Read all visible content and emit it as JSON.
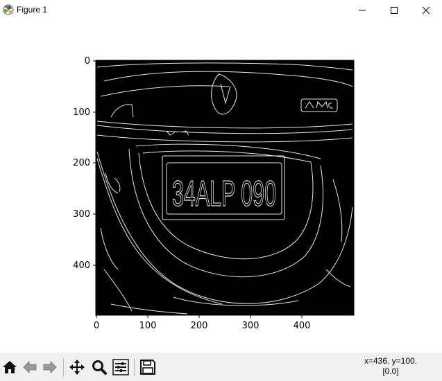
{
  "window": {
    "title": "Figure 1",
    "minimize_icon": "minimize-icon",
    "maximize_icon": "maximize-icon",
    "close_icon": "close-icon"
  },
  "plot": {
    "image": "canny edge-detected car rear with license plate",
    "plate_text": "34ALP 090",
    "x_ticks": [
      "0",
      "100",
      "200",
      "300",
      "400"
    ],
    "y_ticks": [
      "0",
      "100",
      "200",
      "300",
      "400"
    ]
  },
  "toolbar": {
    "buttons": [
      {
        "name": "home",
        "icon": "home-icon"
      },
      {
        "name": "back",
        "icon": "back-arrow-icon"
      },
      {
        "name": "forward",
        "icon": "forward-arrow-icon"
      },
      {
        "name": "pan",
        "icon": "pan-move-icon"
      },
      {
        "name": "zoom",
        "icon": "zoom-magnifier-icon"
      },
      {
        "name": "configure-subplots",
        "icon": "sliders-icon"
      },
      {
        "name": "save",
        "icon": "floppy-disk-icon"
      }
    ],
    "coords_line1": "x=436. y=100.",
    "coords_line2": "[0.0]"
  }
}
